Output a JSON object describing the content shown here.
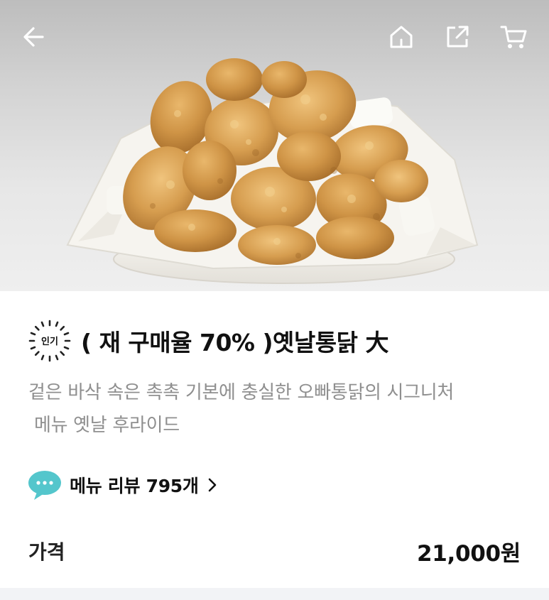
{
  "header": {
    "back_icon": "arrow-left-icon",
    "home_icon": "home-icon",
    "share_icon": "share-icon",
    "cart_icon": "cart-icon",
    "icon_color": "#ffffff"
  },
  "product": {
    "badge": "인기",
    "title": "( 재 구매율 70% )옛날통닭 大",
    "description_lines": [
      "겉은 바삭 속은 촉촉 기본에 충실한 오빠통닭의 시그니처",
      " 메뉴 옛날 후라이드"
    ],
    "review_icon": "chat-bubble-icon",
    "review_label": "메뉴 리뷰 795개",
    "price_label": "가격",
    "price_value": "21,000원"
  },
  "colors": {
    "review_icon": "#54c6cc",
    "description_text": "#8f8f8f",
    "bottom_strip": "#f2f3f6"
  }
}
